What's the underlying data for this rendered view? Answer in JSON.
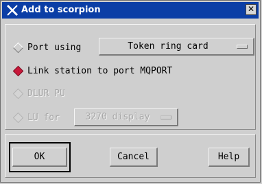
{
  "window": {
    "title": "Add to scorpion",
    "close_glyph": "✕"
  },
  "options": {
    "port_using": {
      "label": "Port using",
      "selected": false,
      "enabled": true,
      "menu_value": "Token ring card"
    },
    "link_station": {
      "label": "Link station to port MQPORT",
      "selected": true,
      "enabled": true
    },
    "dlur_pu": {
      "label": "DLUR PU",
      "selected": false,
      "enabled": false
    },
    "lu_for": {
      "label": "LU for",
      "selected": false,
      "enabled": false,
      "menu_value": "3270 display"
    }
  },
  "buttons": {
    "ok": "OK",
    "cancel": "Cancel",
    "help": "Help"
  },
  "icons": {
    "app": "x-logo-icon",
    "radio": "diamond-radio-icon"
  },
  "colors": {
    "titlebar": "#0b3ea6",
    "selected_radio": "#c8183a",
    "background": "#cfcfcf"
  }
}
